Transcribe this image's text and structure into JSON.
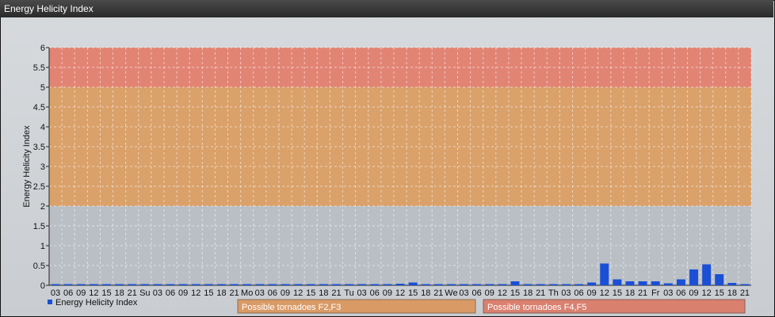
{
  "window": {
    "title": "Energy Helicity Index"
  },
  "chart_data": {
    "type": "bar",
    "ylabel": "Energy Helicity Index",
    "ylim": [
      0,
      6
    ],
    "yticks": [
      "0",
      "0.5",
      "1",
      "1.5",
      "2",
      "2.5",
      "3",
      "3.5",
      "4",
      "4.5",
      "5",
      "5.5",
      "6"
    ],
    "categories": [
      "03",
      "06",
      "09",
      "12",
      "15",
      "18",
      "21",
      "Su",
      "03",
      "06",
      "09",
      "12",
      "15",
      "18",
      "21",
      "Mo",
      "03",
      "06",
      "09",
      "12",
      "15",
      "18",
      "21",
      "Tu",
      "03",
      "06",
      "09",
      "12",
      "15",
      "18",
      "21",
      "We",
      "03",
      "06",
      "09",
      "12",
      "15",
      "18",
      "21",
      "Th",
      "03",
      "06",
      "09",
      "12",
      "15",
      "18",
      "21",
      "Fr",
      "03",
      "06",
      "09",
      "12",
      "15",
      "18",
      "21"
    ],
    "series": [
      {
        "name": "Energy Helicity Index",
        "color": "#1a4fd6",
        "values": [
          0.01,
          0.01,
          0.01,
          0.01,
          0.01,
          0.01,
          0.01,
          0.01,
          0.01,
          0.01,
          0.01,
          0.01,
          0.01,
          0.01,
          0.01,
          0.01,
          0.01,
          0.01,
          0.01,
          0.01,
          0.01,
          0.01,
          0.01,
          0.01,
          0.01,
          0.01,
          0.01,
          0.04,
          0.07,
          0.01,
          0.01,
          0.01,
          0.01,
          0.01,
          0.01,
          0.01,
          0.1,
          0.01,
          0.01,
          0.01,
          0.01,
          0.01,
          0.07,
          0.55,
          0.15,
          0.1,
          0.1,
          0.1,
          0.05,
          0.15,
          0.4,
          0.53,
          0.28,
          0.06,
          0.01
        ]
      }
    ],
    "bands": [
      {
        "from": 0,
        "to": 2,
        "color": "#b9bfc5"
      },
      {
        "from": 2,
        "to": 5,
        "color": "#daa16a"
      },
      {
        "from": 5,
        "to": 6,
        "color": "#e28474"
      }
    ],
    "grid": true,
    "legend_position": "bottom-left",
    "annotations": [
      {
        "label": "Possible tornadoes F2,F3",
        "color": "#d99a66"
      },
      {
        "label": "Possible tornadoes F4,F5",
        "color": "#d9806f"
      }
    ]
  }
}
